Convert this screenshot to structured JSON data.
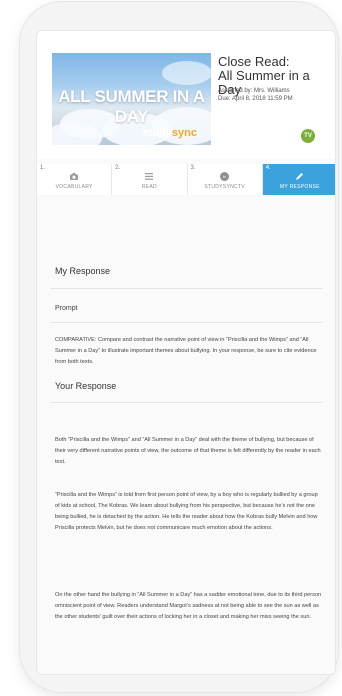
{
  "assignment": {
    "thumbnail_title": "ALL SUMMER IN A DAY",
    "logo_text_1": "study",
    "logo_text_2": "sync",
    "title_line1": "Close Read:",
    "title_line2": "All Summer in a Day",
    "assigned_by": "Assigned by: Mrs. Williams",
    "due": "Due: April 8, 2018 11:59 PM",
    "avatar_initials": "TV"
  },
  "tabs": [
    {
      "number": "1.",
      "label": "VOCABULARY",
      "icon": "camera-icon"
    },
    {
      "number": "2.",
      "label": "READ",
      "icon": "lines-icon"
    },
    {
      "number": "3.",
      "label": "STUDYSYNCTV",
      "icon": "tv-icon"
    },
    {
      "number": "4.",
      "label": "MY RESPONSE",
      "icon": "pencil-icon",
      "active": true
    }
  ],
  "response": {
    "heading": "My Response",
    "prompt_label": "Prompt",
    "prompt_text": "COMPARATIVE: Compare and contrast the narrative point of view in “Priscilla and the Wimps” and “All Summer in a Day” to illustrate important themes about bullying. In your response, be sure to cite evidence from both texts.",
    "your_response_heading": "Your Response",
    "paragraphs": [
      "Both “Priscilla and the Wimps” and “All Summer in a Day” deal with the theme of bullying, but because of their very different narrative points of view, the outcome of that theme is felt differently by the reader in each text.",
      "“Priscilla and the Wimps” is told from first person point of view, by a boy who is regularly bullied by a group of kids at school, The Kobras. We learn about bullying from his perspective, but because he’s not the one being bullied, he is detached by the action. He tells the reader about how the Kobras bully Melvin and how Priscilla protects Melvin, but he does not communicare much emotion about the actions.",
      "On the other hand the bullying in “All Summer in a Day” has a sadder emotional tone, due to its third person omniscient point of view. Readers understand Margot’s sadness at not being able to see the sun as well as the other students’ guilt over their actions of locking her in a closet and making her miss seeing the sun."
    ]
  }
}
